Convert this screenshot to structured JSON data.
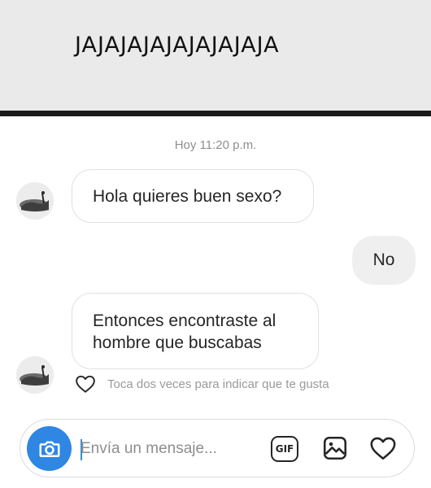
{
  "meme_caption": "JAJAJAJAJAJAJAJAJA",
  "chat": {
    "timestamp": "Hoy 11:20 p.m.",
    "messages": [
      {
        "sender": "them",
        "text": "Hola quieres buen sexo?"
      },
      {
        "sender": "me",
        "text": "No"
      },
      {
        "sender": "them",
        "lines": [
          "Entonces encontraste al",
          "hombre que buscabas"
        ]
      }
    ],
    "like_hint": "Toca dos veces para indicar que te gusta"
  },
  "composer": {
    "placeholder": "Envía un mensaje...",
    "gif_label": "GIF",
    "icons": [
      "camera-icon",
      "gif-icon",
      "gallery-icon",
      "heart-icon"
    ]
  },
  "colors": {
    "accent": "#2f86e3",
    "caption_bg": "#eaeaea",
    "divider": "#1c1c1c",
    "outgoing_bubble": "#efefef",
    "muted_text": "#8e8e8e"
  }
}
